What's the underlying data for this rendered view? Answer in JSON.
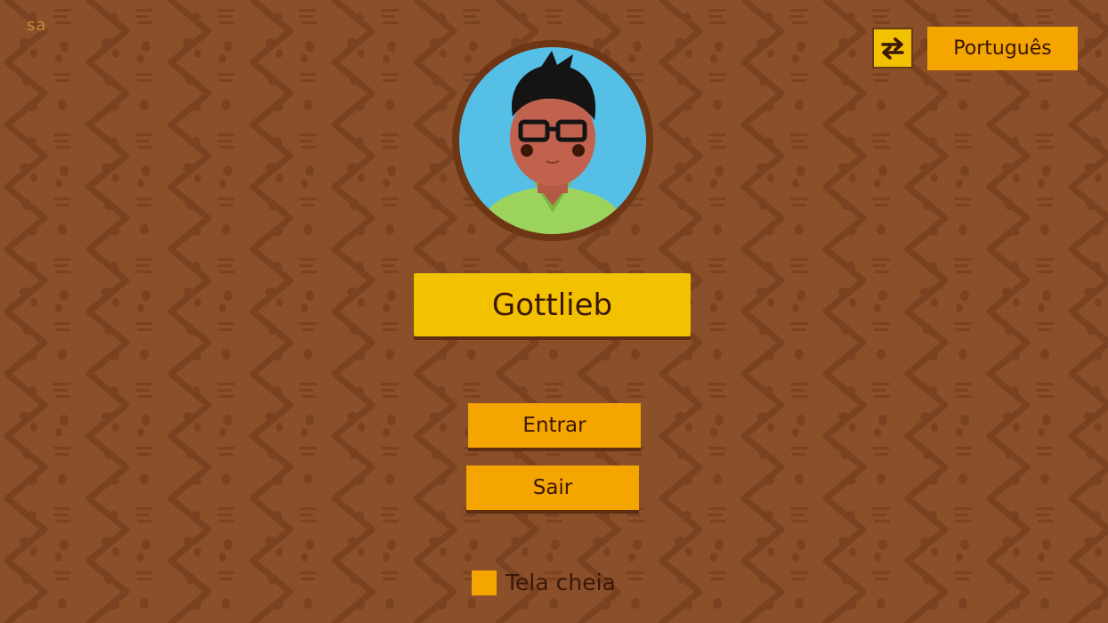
{
  "corner_tag": "sa",
  "language_switcher": {
    "icon": "swap-arrows-icon",
    "label": "Português"
  },
  "profile": {
    "avatar_icon": "boy-with-glasses-avatar",
    "name": "Gottlieb"
  },
  "menu": {
    "enter_label": "Entrar",
    "exit_label": "Sair"
  },
  "fullscreen": {
    "label": "Tela cheia",
    "checked": false
  },
  "colors": {
    "background": "#8b4f2a",
    "pattern": "#7a4220",
    "name_box": "#f2c100",
    "button": "#f5a500",
    "text_dark": "#3b1708"
  }
}
